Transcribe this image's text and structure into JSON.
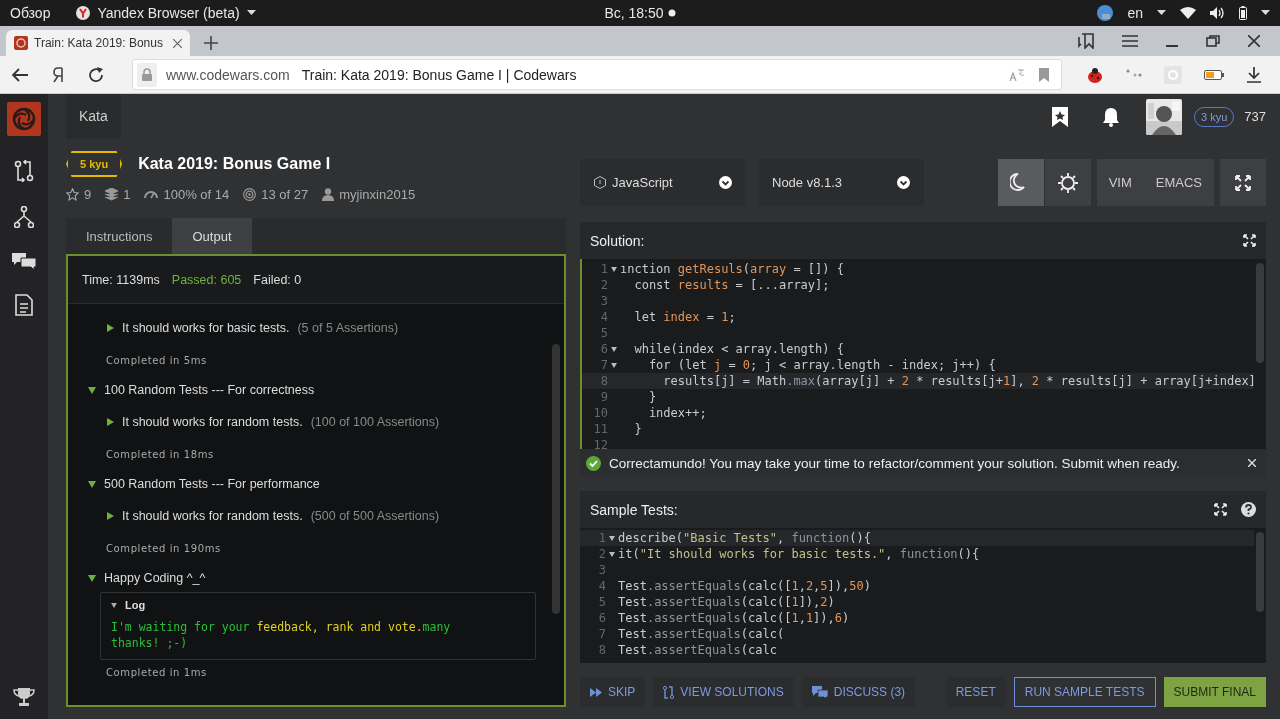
{
  "system_bar": {
    "overview": "Обзор",
    "app_name": "Yandex Browser (beta)",
    "clock": "Вс, 18:50",
    "language": "en"
  },
  "browser": {
    "tab": {
      "title": "Train: Kata 2019: Bonus",
      "selected": true
    },
    "address": {
      "domain": "www.codewars.com",
      "page_title": "Train: Kata 2019: Bonus Game I | Codewars"
    }
  },
  "header": {
    "nav_tab": "Kata",
    "rank": "3 kyu",
    "honor": "737"
  },
  "kata": {
    "rank": "5 kyu",
    "title": "Kata 2019: Bonus Game I",
    "stats": [
      {
        "kind": "stars",
        "text": "9"
      },
      {
        "kind": "collections",
        "text": "1"
      },
      {
        "kind": "satisfaction",
        "text": "100% of 14"
      },
      {
        "kind": "completions",
        "text": "13 of 27"
      },
      {
        "kind": "author",
        "text": "myjinxin2015"
      }
    ]
  },
  "tabs": [
    {
      "label": "Instructions",
      "selected": false
    },
    {
      "label": "Output",
      "selected": true
    }
  ],
  "output": {
    "time": "Time: 1139ms",
    "passed": "Passed: 605",
    "failed": "Failed: 0",
    "results": [
      {
        "kind": "test",
        "text": "It should works for basic tests.",
        "assertions": "(5 of 5 Assertions)",
        "expanded": false
      },
      {
        "kind": "completed",
        "text": "Completed in 5ms"
      },
      {
        "kind": "group",
        "title": "100 Random Tests --- For correctness",
        "expanded": true,
        "children": [
          {
            "kind": "test",
            "text": "It should works for random tests.",
            "assertions": "(100 of 100 Assertions)",
            "expanded": false
          },
          {
            "kind": "completed",
            "text": "Completed in 18ms"
          }
        ]
      },
      {
        "kind": "group",
        "title": "500 Random Tests --- For performance",
        "expanded": true,
        "children": [
          {
            "kind": "test",
            "text": "It should works for random tests.",
            "assertions": "(500 of 500 Assertions)",
            "expanded": false
          },
          {
            "kind": "completed",
            "text": "Completed in 190ms"
          }
        ]
      },
      {
        "kind": "group",
        "title": "Happy Coding ^_^",
        "expanded": true,
        "children": [
          {
            "kind": "log",
            "title": "Log",
            "expanded": true,
            "segments": [
              {
                "text": "I'm waiting for your ",
                "kind": "info"
              },
              {
                "text": "feedback, rank and vote.",
                "kind": "highlight"
              },
              {
                "text": "many thanks! ;-)",
                "kind": "info"
              }
            ]
          },
          {
            "kind": "completed",
            "text": "Completed in 1ms"
          }
        ]
      }
    ]
  },
  "language": {
    "label": "JavaScript"
  },
  "runtime": {
    "label": "Node v8.1.3"
  },
  "themes": [
    {
      "kind": "dark",
      "selected": true
    },
    {
      "kind": "light",
      "selected": false
    }
  ],
  "keymaps": [
    {
      "label": "VIM",
      "selected": false
    },
    {
      "label": "EMACS",
      "selected": false
    }
  ],
  "solution": {
    "title": "Solution:",
    "lines": [
      {
        "number": "1",
        "fold": true,
        "active": false,
        "segments": [
          {
            "text": "ınction ",
            "kind": "plain"
          },
          {
            "text": "getResuls",
            "kind": "name"
          },
          {
            "text": "(",
            "kind": "plain"
          },
          {
            "text": "array",
            "kind": "name"
          },
          {
            "text": " = []) {",
            "kind": "plain"
          }
        ]
      },
      {
        "number": "2",
        "fold": false,
        "active": false,
        "segments": [
          {
            "text": "  const ",
            "kind": "plain"
          },
          {
            "text": "results",
            "kind": "name"
          },
          {
            "text": " = [...array];",
            "kind": "plain"
          }
        ]
      },
      {
        "number": "3",
        "fold": false,
        "active": false
      },
      {
        "number": "4",
        "fold": false,
        "active": false,
        "segments": [
          {
            "text": "  let ",
            "kind": "plain"
          },
          {
            "text": "index",
            "kind": "name"
          },
          {
            "text": " = ",
            "kind": "plain"
          },
          {
            "text": "1",
            "kind": "number"
          },
          {
            "text": ";",
            "kind": "plain"
          }
        ]
      },
      {
        "number": "5",
        "fold": false,
        "active": false
      },
      {
        "number": "6",
        "fold": true,
        "active": false,
        "segments": [
          {
            "text": "  while(index < array.length) {",
            "kind": "plain"
          }
        ]
      },
      {
        "number": "7",
        "fold": true,
        "active": false,
        "segments": [
          {
            "text": "    for (let ",
            "kind": "plain"
          },
          {
            "text": "j",
            "kind": "name"
          },
          {
            "text": " = ",
            "kind": "plain"
          },
          {
            "text": "0",
            "kind": "number"
          },
          {
            "text": "; j < array.length - index; j++) {",
            "kind": "plain"
          }
        ]
      },
      {
        "number": "8",
        "fold": false,
        "active": true,
        "segments": [
          {
            "text": "      results[j] = Math",
            "kind": "plain"
          },
          {
            "text": ".max",
            "kind": "method"
          },
          {
            "text": "(array[j] + ",
            "kind": "plain"
          },
          {
            "text": "2",
            "kind": "number"
          },
          {
            "text": " * results[j+",
            "kind": "plain"
          },
          {
            "text": "1",
            "kind": "number"
          },
          {
            "text": "], ",
            "kind": "plain"
          },
          {
            "text": "2",
            "kind": "number"
          },
          {
            "text": " * results[j] + array[j+index]",
            "kind": "plain"
          }
        ]
      },
      {
        "number": "9",
        "fold": false,
        "active": false,
        "segments": [
          {
            "text": "    }",
            "kind": "plain"
          }
        ]
      },
      {
        "number": "10",
        "fold": false,
        "active": false,
        "segments": [
          {
            "text": "    index++;",
            "kind": "plain"
          }
        ]
      },
      {
        "number": "11",
        "fold": false,
        "active": false,
        "segments": [
          {
            "text": "  }",
            "kind": "plain"
          }
        ]
      },
      {
        "number": "12",
        "fold": false,
        "active": false
      }
    ]
  },
  "notification": {
    "text": "Correctamundo! You may take your time to refactor/comment your solution. Submit when ready."
  },
  "sample_tests": {
    "title": "Sample Tests:",
    "lines": [
      {
        "number": "1",
        "fold": true,
        "active": true,
        "segments": [
          {
            "text": "describe(",
            "kind": "plain"
          },
          {
            "text": "\"Basic Tests\"",
            "kind": "string"
          },
          {
            "text": ", ",
            "kind": "plain"
          },
          {
            "text": "function",
            "kind": "method"
          },
          {
            "text": "(){",
            "kind": "plain"
          }
        ]
      },
      {
        "number": "2",
        "fold": true,
        "active": false,
        "segments": [
          {
            "text": "it(",
            "kind": "plain"
          },
          {
            "text": "\"It should works for basic tests.\"",
            "kind": "string"
          },
          {
            "text": ", ",
            "kind": "plain"
          },
          {
            "text": "function",
            "kind": "method"
          },
          {
            "text": "(){",
            "kind": "plain"
          }
        ]
      },
      {
        "number": "3",
        "fold": false,
        "active": false
      },
      {
        "number": "4",
        "fold": false,
        "active": false,
        "segments": [
          {
            "text": "Test",
            "kind": "plain"
          },
          {
            "text": ".assertEquals",
            "kind": "method"
          },
          {
            "text": "(calc([",
            "kind": "plain"
          },
          {
            "text": "1",
            "kind": "number"
          },
          {
            "text": ",",
            "kind": "plain"
          },
          {
            "text": "2",
            "kind": "number"
          },
          {
            "text": ",",
            "kind": "plain"
          },
          {
            "text": "5",
            "kind": "number"
          },
          {
            "text": "]),",
            "kind": "plain"
          },
          {
            "text": "50",
            "kind": "number"
          },
          {
            "text": ")",
            "kind": "plain"
          }
        ]
      },
      {
        "number": "5",
        "fold": false,
        "active": false,
        "segments": [
          {
            "text": "Test",
            "kind": "plain"
          },
          {
            "text": ".assertEquals",
            "kind": "method"
          },
          {
            "text": "(calc([",
            "kind": "plain"
          },
          {
            "text": "1",
            "kind": "number"
          },
          {
            "text": "]),",
            "kind": "plain"
          },
          {
            "text": "2",
            "kind": "number"
          },
          {
            "text": ")",
            "kind": "plain"
          }
        ]
      },
      {
        "number": "6",
        "fold": false,
        "active": false,
        "segments": [
          {
            "text": "Test",
            "kind": "plain"
          },
          {
            "text": ".assertEquals",
            "kind": "method"
          },
          {
            "text": "(calc([",
            "kind": "plain"
          },
          {
            "text": "1",
            "kind": "number"
          },
          {
            "text": ",",
            "kind": "plain"
          },
          {
            "text": "1",
            "kind": "number"
          },
          {
            "text": "]),",
            "kind": "plain"
          },
          {
            "text": "6",
            "kind": "number"
          },
          {
            "text": ")",
            "kind": "plain"
          }
        ]
      },
      {
        "number": "7",
        "fold": false,
        "active": false,
        "segments": [
          {
            "text": "Test",
            "kind": "plain"
          },
          {
            "text": ".assertEquals",
            "kind": "method"
          },
          {
            "text": "(calc(",
            "kind": "plain"
          }
        ]
      },
      {
        "number": "8",
        "fold": false,
        "active": false,
        "segments": [
          {
            "text": "Test",
            "kind": "plain"
          },
          {
            "text": ".assertEquals",
            "kind": "method"
          },
          {
            "text": "(calc",
            "kind": "plain"
          }
        ]
      }
    ]
  },
  "actions": [
    {
      "kind": "skip",
      "label": "SKIP"
    },
    {
      "kind": "solutions",
      "label": "VIEW SOLUTIONS"
    },
    {
      "kind": "discuss",
      "label": "DISCUSS (3)"
    },
    {
      "kind": "plain",
      "label": "RESET"
    },
    {
      "kind": "outline",
      "label": "RUN SAMPLE TESTS"
    },
    {
      "kind": "primary",
      "label": "SUBMIT FINAL"
    }
  ]
}
